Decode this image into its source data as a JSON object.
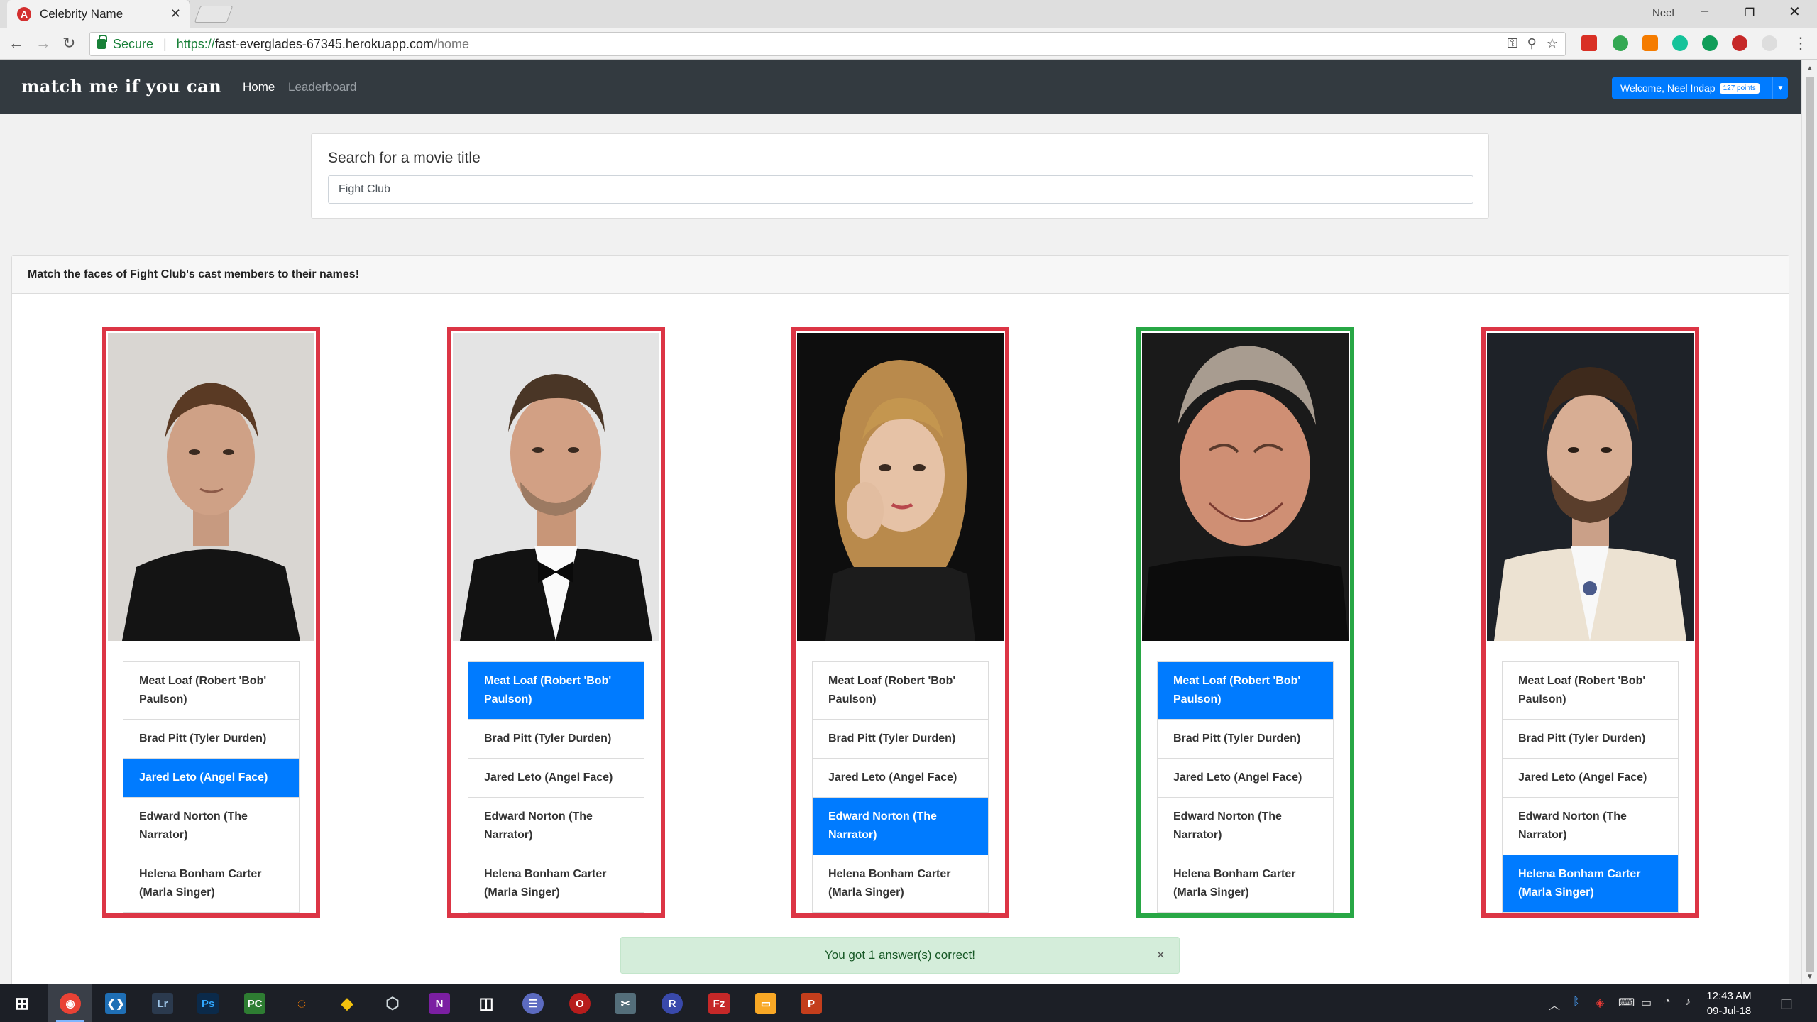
{
  "browser": {
    "tab_title": "Celebrity Name",
    "favicon": "A",
    "window_user": "Neel",
    "url_secure_label": "Secure",
    "url_scheme": "https://",
    "url_host": "fast-everglades-67345.herokuapp.com",
    "url_path": "/home"
  },
  "app": {
    "brand": "match me if you can",
    "nav": [
      "Home",
      "Leaderboard"
    ],
    "welcome": "Welcome, Neel Indap",
    "points": "127 points"
  },
  "search": {
    "title": "Search for a movie title",
    "value": "Fight Club"
  },
  "match": {
    "header": "Match the faces of Fight Club's cast members to their names!",
    "options": [
      "Meat Loaf (Robert 'Bob' Paulson)",
      "Brad Pitt (Tyler Durden)",
      "Jared Leto (Angel Face)",
      "Edward Norton (The Narrator)",
      "Helena Bonham Carter (Marla Singer)"
    ],
    "cards": [
      {
        "photo": "photo-man-brown-hair-black-shirt",
        "selected": 2,
        "correct": false
      },
      {
        "photo": "photo-man-tuxedo-bowtie",
        "selected": 0,
        "correct": false
      },
      {
        "photo": "photo-woman-curly-blonde-hair",
        "selected": 3,
        "correct": false
      },
      {
        "photo": "photo-man-smiling-grey-hair",
        "selected": 0,
        "correct": true
      },
      {
        "photo": "photo-man-long-hair-beard",
        "selected": 4,
        "correct": false
      }
    ]
  },
  "result": {
    "message": "You got 1 answer(s) correct!",
    "close": "×"
  },
  "taskbar": {
    "time": "12:43 AM",
    "date": "09-Jul-18"
  },
  "colors": {
    "navbar": "#333a40",
    "primary": "#007bff",
    "wrong_border": "#dc3545",
    "correct_border": "#28a745",
    "alert_bg": "#d4edda",
    "alert_text": "#155724"
  }
}
